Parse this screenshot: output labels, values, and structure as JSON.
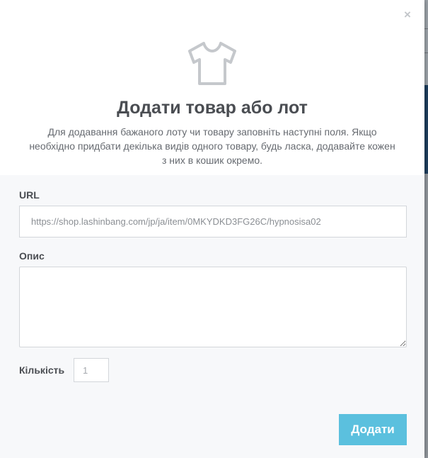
{
  "modal": {
    "close_symbol": "×",
    "icon": "tshirt-icon",
    "title": "Додати товар або лот",
    "subtitle": "Для додавання бажаного лоту чи товару заповніть наступні поля. Якщо необхідно придбати декілька видів одного товару, будь ласка, додавайте кожен з них в кошик окремо."
  },
  "form": {
    "url_label": "URL",
    "url_placeholder": "https://shop.lashinbang.com/jp/ja/item/0MKYDKD3FG26C/hypnosisa02",
    "description_label": "Опис",
    "description_value": "",
    "quantity_label": "Кількість",
    "quantity_placeholder": "1",
    "submit_label": "Додати"
  },
  "colors": {
    "accent": "#5bc0de",
    "title_text": "#4a4d52",
    "body_text": "#666a70",
    "icon_stroke": "#c5c8cc"
  }
}
